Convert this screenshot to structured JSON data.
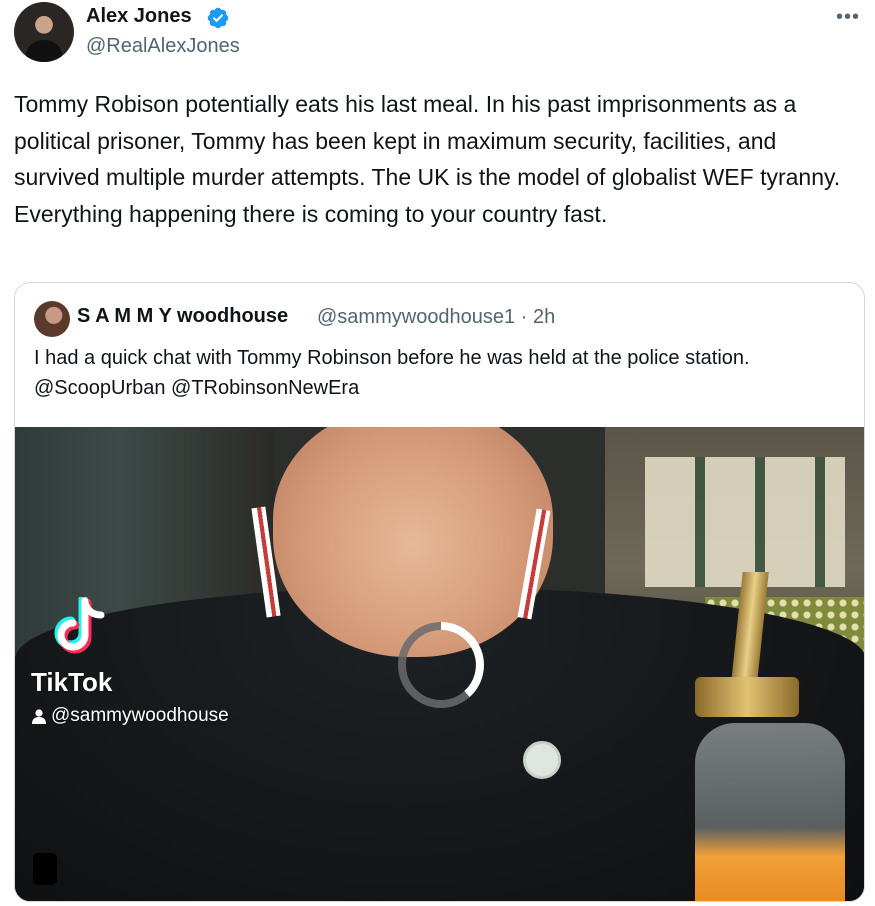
{
  "tweet": {
    "author_name": "Alex Jones",
    "author_handle": "@RealAlexJones",
    "text": "Tommy Robison potentially eats his last meal. In his past imprisonments as a political prisoner, Tommy has been kept in maximum security, facilities, and survived multiple murder attempts. The UK is the model of globalist WEF tyranny. Everything happening there is coming to your country fast.",
    "more_icon": "more-horizontal-icon",
    "verified_icon": "verified-badge-icon",
    "verified_color": "#1d9bf0"
  },
  "quote": {
    "author_name": "S A M M Y woodhouse",
    "author_handle": "@sammywoodhouse1 · 2h",
    "text": "I had a quick chat with Tommy Robinson before he was held at the police station. @ScoopUrban @TRobinsonNewEra",
    "video": {
      "watermark_brand": "TikTok",
      "watermark_user": "@sammywoodhouse",
      "state": "loading"
    }
  },
  "colors": {
    "text_primary": "#0f1419",
    "text_secondary": "#536471",
    "border": "#cfd9de",
    "tiktok_cyan": "#25f4ee",
    "tiktok_pink": "#fe2c55"
  }
}
